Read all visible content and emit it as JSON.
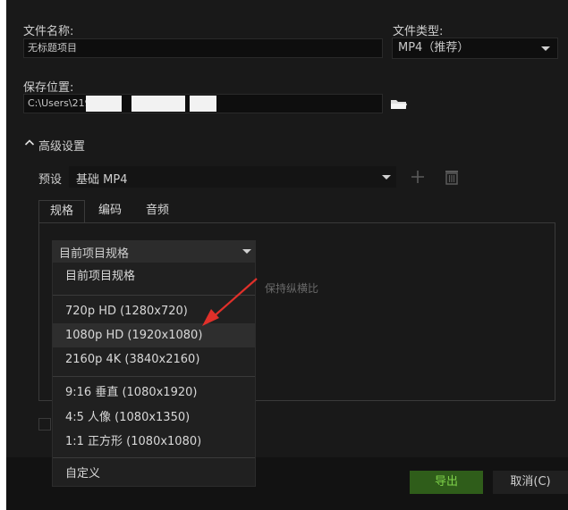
{
  "file_name": {
    "label": "文件名称:",
    "value": "无标题项目"
  },
  "file_type": {
    "label": "文件类型:",
    "value": "MP4（推荐）"
  },
  "save_location": {
    "label": "保存位置:",
    "value": "C:\\Users\\219"
  },
  "advanced": {
    "label": "高级设置"
  },
  "preset": {
    "label": "预设",
    "value": "基础 MP4"
  },
  "tabs": [
    "规格",
    "编码",
    "音频"
  ],
  "spec_select": {
    "value": "目前项目规格"
  },
  "keep_ratio_label": "保持纵横比",
  "dropdown_options": [
    "目前项目规格",
    "720p HD (1280x720)",
    "1080p HD (1920x1080)",
    "2160p 4K (3840x2160)",
    "9:16 垂直 (1080x1920)",
    "4:5 人像 (1080x1350)",
    "1:1 正方形 (1080x1080)",
    "自定义"
  ],
  "buttons": {
    "export": "导出",
    "cancel": "取消(C)"
  },
  "colors": {
    "export_bg": "#2f5d1a",
    "export_text": "#7fd24a",
    "arrow": "#e0302a"
  }
}
